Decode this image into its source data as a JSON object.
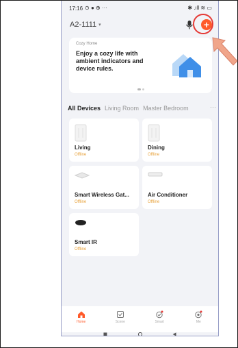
{
  "statusbar": {
    "time": "17:16",
    "left_icons": "⊙ ● ⊕ ···",
    "right_icons": "✱ .ıll ≋ ▭"
  },
  "header": {
    "home_name": "A2-1111",
    "caret": "▾",
    "add_symbol": "+"
  },
  "banner": {
    "kicker": "Cozy Home",
    "headline": "Enjoy a cozy life with ambient indicators and device rules."
  },
  "tabs": {
    "items": [
      "All Devices",
      "Living Room",
      "Master Bedroom"
    ],
    "more": "···"
  },
  "devices": [
    {
      "name": "Living",
      "status": "Offline"
    },
    {
      "name": "Dining",
      "status": "Offline"
    },
    {
      "name": "Smart Wireless Gat...",
      "status": "Offline"
    },
    {
      "name": "Air Conditioner",
      "status": "Offline"
    },
    {
      "name": "Smart IR",
      "status": "Offline"
    }
  ],
  "tabbar": [
    {
      "label": "Home",
      "icon": "home-icon",
      "active": true
    },
    {
      "label": "Scene",
      "icon": "scene-icon",
      "active": false
    },
    {
      "label": "Smart",
      "icon": "smart-icon",
      "active": false
    },
    {
      "label": "Me",
      "icon": "me-icon",
      "active": false
    }
  ],
  "colors": {
    "accent": "#ff5a2a",
    "offline": "#e8a23b",
    "annotation": "#e53935",
    "arrow": "#f0a58a"
  }
}
